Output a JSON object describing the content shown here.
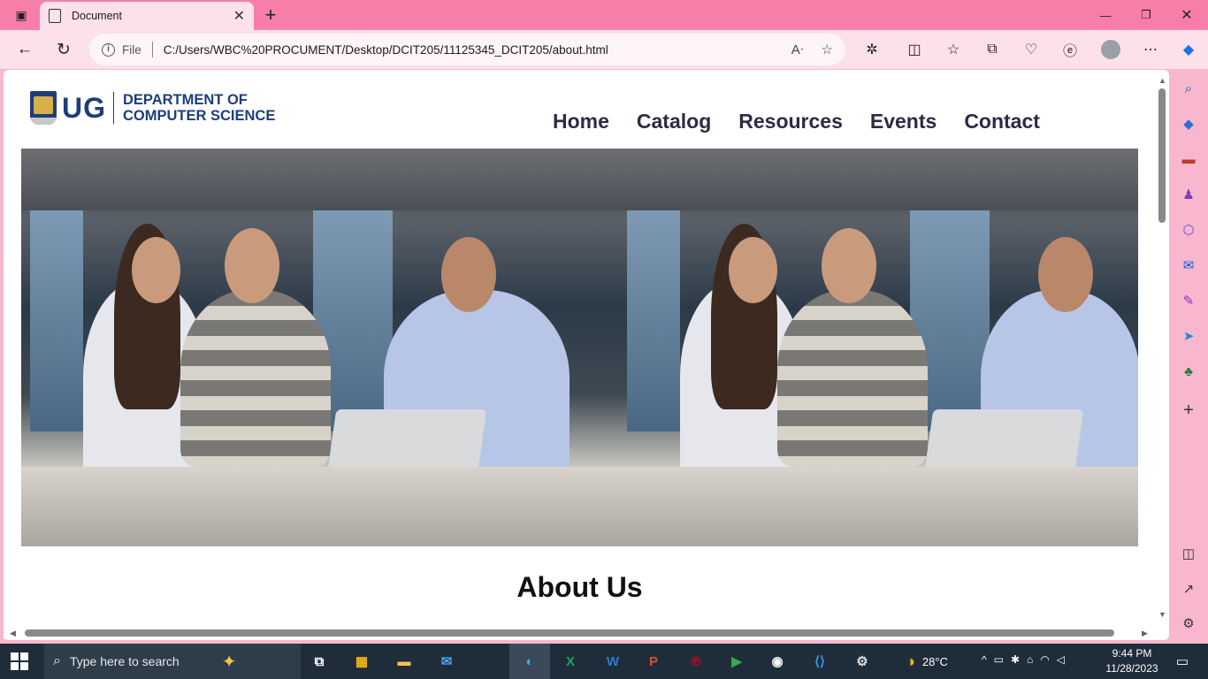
{
  "browser": {
    "tab_title": "Document",
    "address_file_label": "File",
    "address_url": "C:/Users/WBC%20PROCUMENT/Desktop/DCIT205/11125345_DCIT205/about.html"
  },
  "page": {
    "logo_ug": "UG",
    "logo_dept_line1": "DEPARTMENT OF",
    "logo_dept_line2": "COMPUTER SCIENCE",
    "nav": [
      "Home",
      "Catalog",
      "Resources",
      "Events",
      "Contact"
    ],
    "heading": "About Us"
  },
  "taskbar": {
    "search_placeholder": "Type here to search",
    "temperature": "28°C",
    "time": "9:44 PM",
    "date": "11/28/2023"
  },
  "colors": {
    "titlebar": "#f87eaa",
    "toolbar": "#fce1ea",
    "brand_navy": "#1e3e7a",
    "nav_text": "#2b2b44",
    "taskbar": "#1f2d3a"
  }
}
